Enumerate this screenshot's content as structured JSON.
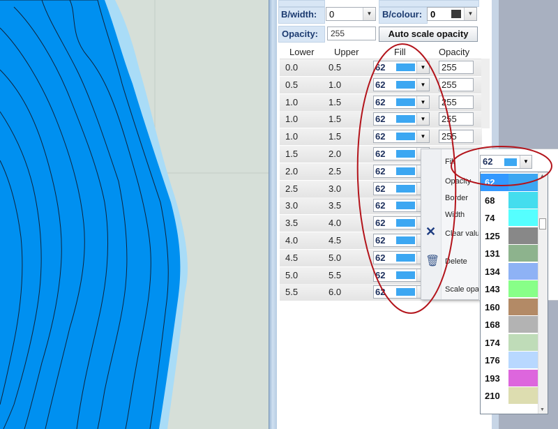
{
  "top": {
    "bwidth_label": "B/width:",
    "bwidth_value": "0",
    "bcolour_label": "B/colour:",
    "bcolour_value": "0",
    "bcolour_swatch": "#3a3a3a",
    "opacity_label": "Opacity:",
    "opacity_value": "255",
    "auto_scale_button": "Auto scale opacity"
  },
  "grid": {
    "headers": [
      "Lower",
      "Upper",
      "Fill",
      "Opacity"
    ],
    "rows": [
      {
        "lower": "0.0",
        "upper": "0.5",
        "fill": "62",
        "opacity": "255"
      },
      {
        "lower": "0.5",
        "upper": "1.0",
        "fill": "62",
        "opacity": "255"
      },
      {
        "lower": "1.0",
        "upper": "1.5",
        "fill": "62",
        "opacity": "255"
      },
      {
        "lower": "1.0",
        "upper": "1.5",
        "fill": "62",
        "opacity": "255"
      },
      {
        "lower": "1.0",
        "upper": "1.5",
        "fill": "62",
        "opacity": "255"
      },
      {
        "lower": "1.5",
        "upper": "2.0",
        "fill": "62",
        "opacity": ""
      },
      {
        "lower": "2.0",
        "upper": "2.5",
        "fill": "62",
        "opacity": ""
      },
      {
        "lower": "2.5",
        "upper": "3.0",
        "fill": "62",
        "opacity": ""
      },
      {
        "lower": "3.0",
        "upper": "3.5",
        "fill": "62",
        "opacity": ""
      },
      {
        "lower": "3.5",
        "upper": "4.0",
        "fill": "62",
        "opacity": ""
      },
      {
        "lower": "4.0",
        "upper": "4.5",
        "fill": "62",
        "opacity": ""
      },
      {
        "lower": "4.5",
        "upper": "5.0",
        "fill": "62",
        "opacity": ""
      },
      {
        "lower": "5.0",
        "upper": "5.5",
        "fill": "62",
        "opacity": ""
      },
      {
        "lower": "5.5",
        "upper": "6.0",
        "fill": "62",
        "opacity": ""
      }
    ],
    "fill_swatch": "#3ca7f2"
  },
  "context_menu": {
    "fill": "Fill",
    "opacity": "Opacity",
    "border": "Border",
    "width": "Width",
    "clear_values": "Clear valu",
    "delete": "Delete",
    "scale_opacity": "Scale opa"
  },
  "sub_fill": {
    "value": "62",
    "swatch": "#3ca7f2"
  },
  "dropdown": {
    "items": [
      {
        "n": "62",
        "c": "#3ca7f2"
      },
      {
        "n": "68",
        "c": "#44ddee"
      },
      {
        "n": "74",
        "c": "#55ffff"
      },
      {
        "n": "125",
        "c": "#888888"
      },
      {
        "n": "131",
        "c": "#8db38d"
      },
      {
        "n": "134",
        "c": "#8eb2f5"
      },
      {
        "n": "143",
        "c": "#88ff88"
      },
      {
        "n": "160",
        "c": "#b38a66"
      },
      {
        "n": "168",
        "c": "#b3b3b3"
      },
      {
        "n": "174",
        "c": "#bfdcb8"
      },
      {
        "n": "176",
        "c": "#b8d8ff"
      },
      {
        "n": "193",
        "c": "#dd66dd"
      },
      {
        "n": "210",
        "c": "#ddddb0"
      }
    ],
    "selected": "62"
  },
  "colors": {
    "map_water": "#0090f0",
    "map_shallow": "#a9dcf7",
    "annotation": "#b3141b"
  }
}
